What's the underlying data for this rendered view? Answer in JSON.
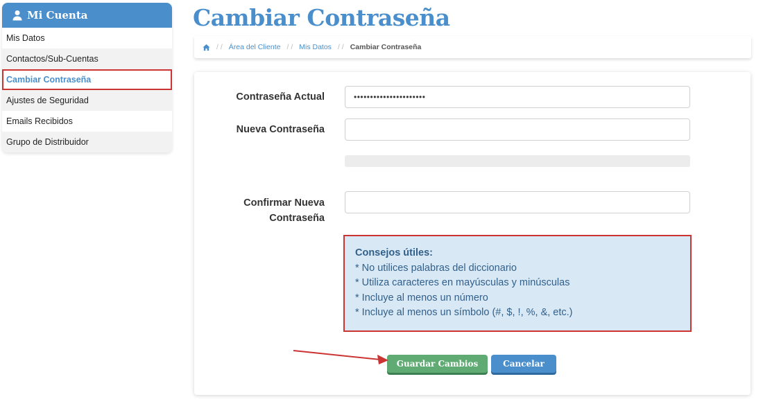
{
  "sidebar": {
    "title": "Mi Cuenta",
    "items": [
      {
        "label": "Mis Datos"
      },
      {
        "label": "Contactos/Sub-Cuentas"
      },
      {
        "label": "Cambiar Contraseña"
      },
      {
        "label": "Ajustes de Seguridad"
      },
      {
        "label": "Emails Recibidos"
      },
      {
        "label": "Grupo de Distribuidor"
      }
    ],
    "active_index": 2
  },
  "page": {
    "title": "Cambiar Contraseña"
  },
  "breadcrumb": {
    "home_icon": "home-icon",
    "items": [
      "Área del Cliente",
      "Mis Datos"
    ],
    "current": "Cambiar Contraseña",
    "separator": "/ /"
  },
  "form": {
    "current_password": {
      "label": "Contraseña Actual",
      "value": "••••••••••••••••••••••"
    },
    "new_password": {
      "label": "Nueva Contraseña",
      "value": ""
    },
    "confirm_password": {
      "label_line1": "Confirmar Nueva",
      "label_line2": "Contraseña",
      "value": ""
    }
  },
  "tips": {
    "title": "Consejos útiles:",
    "items": [
      "* No utilices palabras del diccionario",
      "* Utiliza caracteres en mayúsculas y minúsculas",
      "* Incluye al menos un número",
      "* Incluye al menos un símbolo (#, $, !, %, &, etc.)"
    ]
  },
  "buttons": {
    "save": "Guardar Cambios",
    "cancel": "Cancelar"
  },
  "colors": {
    "accent": "#4a8fcb",
    "save": "#5fab73",
    "highlight": "#cc3333",
    "tips_bg": "#d9e8f5"
  }
}
